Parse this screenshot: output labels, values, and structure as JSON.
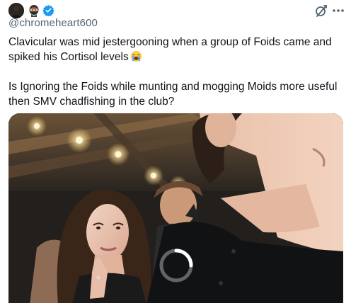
{
  "header": {
    "handle": "@chromeheart600",
    "avatar_icon": "profile-photo",
    "badge_emoji": "ninja-emoji",
    "verified_color": "#1d9bf0"
  },
  "tweet": {
    "line1": "Clavicular was mid jestergooning when a group of Foids came and spiked his Cortisol levels",
    "line1_emoji": "loudly-crying-face",
    "line2": "Is Ignoring the Foids while munting and mogging Moids more useful then SMV chadfishing in the club?"
  },
  "media": {
    "type": "video",
    "state": "loading"
  },
  "colors": {
    "text": "#0f1419",
    "secondary": "#536471",
    "accent": "#1d9bf0"
  }
}
